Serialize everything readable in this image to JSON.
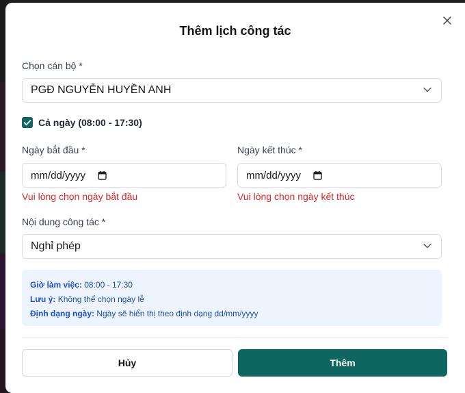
{
  "dialog": {
    "title": "Thêm lịch công tác",
    "close_icon": "close-icon"
  },
  "staff": {
    "label": "Chọn cán bộ *",
    "selected": "PGĐ NGUYỄN HUYỀN ANH"
  },
  "all_day": {
    "checked": true,
    "label": "Cả ngày (08:00 - 17:30)"
  },
  "start_date": {
    "label": "Ngày bắt đầu *",
    "placeholder": "mm/dd/yyyy",
    "error": "Vui lòng chọn ngày bắt đầu"
  },
  "end_date": {
    "label": "Ngày kết thúc *",
    "placeholder": "mm/dd/yyyy",
    "error": "Vui lòng chọn ngày kết thúc"
  },
  "content": {
    "label": "Nội dung công tác *",
    "selected": "Nghỉ phép"
  },
  "info": {
    "work_hours_label": "Giờ làm việc:",
    "work_hours_value": "08:00 - 17:30",
    "note_label": "Lưu ý:",
    "note_value": "Không thể chọn ngày lễ",
    "format_label": "Định dạng ngày:",
    "format_value": "Ngày sẽ hiển thị theo định dạng dd/mm/yyyy"
  },
  "actions": {
    "cancel": "Hủy",
    "add": "Thêm"
  },
  "colors": {
    "primary": "#0f6661",
    "error": "#dc2626",
    "info_bg": "#eef4fd",
    "info_text": "#1d4ed8"
  }
}
